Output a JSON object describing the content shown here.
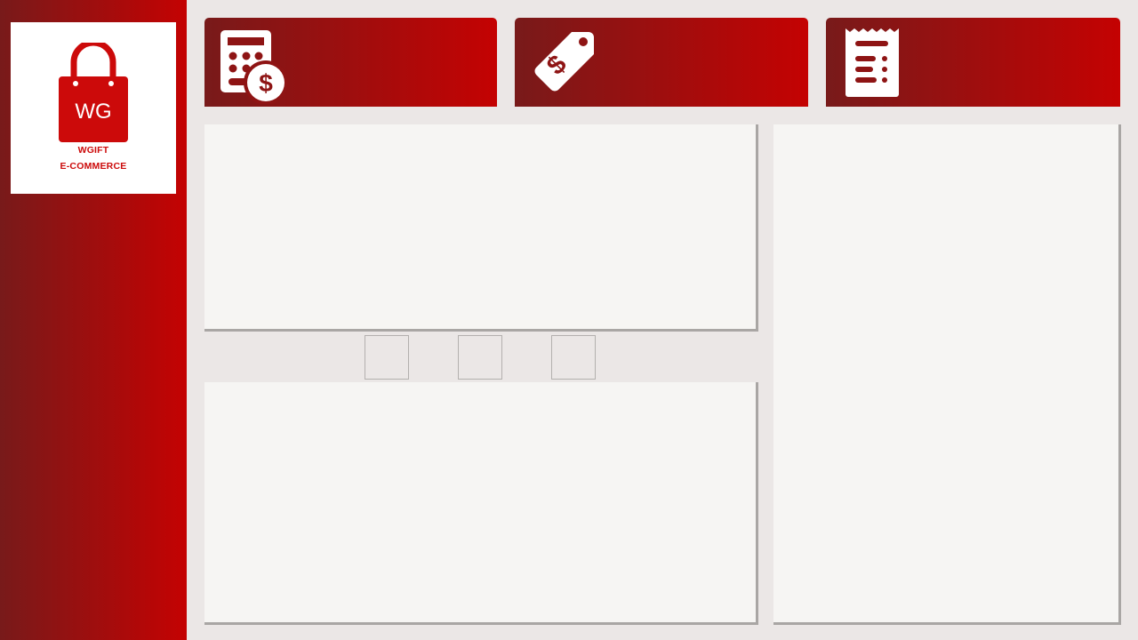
{
  "brand": {
    "logo_initials": "WG",
    "name_line1": "WGIFT",
    "name_line2": "E-COMMERCE",
    "accent_color": "#cc0a0a",
    "gradient_start": "#781a1a",
    "gradient_end": "#c40202"
  },
  "header_cards": [
    {
      "icon": "calculator-dollar-icon"
    },
    {
      "icon": "price-tag-dollar-icon"
    },
    {
      "icon": "receipt-icon"
    }
  ],
  "pager": {
    "count": 3
  },
  "colors": {
    "background": "#ebe7e6",
    "panel": "#f6f5f3",
    "panel_shadow": "#a9a6a4"
  }
}
